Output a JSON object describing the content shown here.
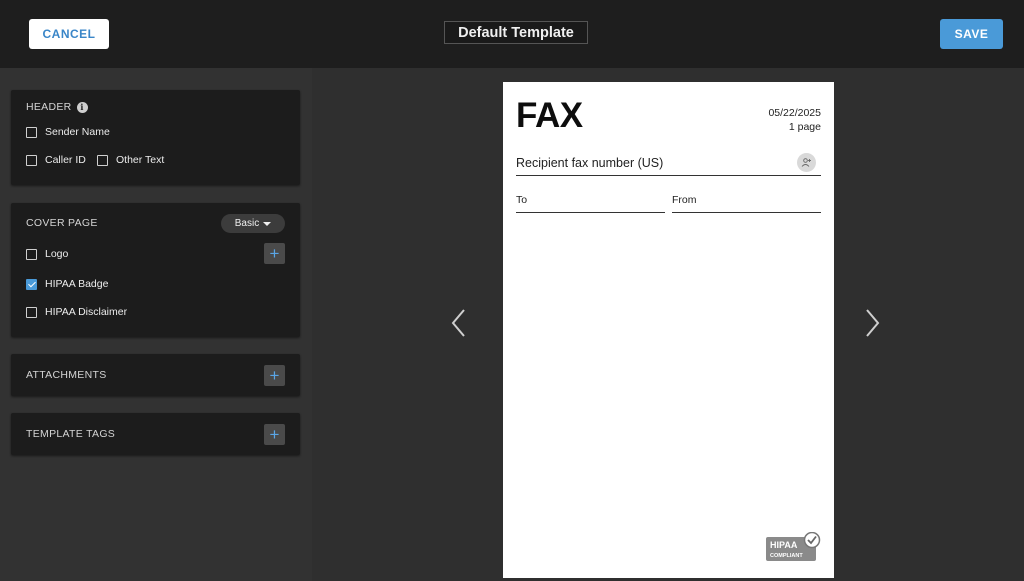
{
  "topbar": {
    "cancel_label": "CANCEL",
    "title": "Default Template",
    "save_label": "SAVE"
  },
  "left_panel": {
    "header": {
      "title": "HEADER",
      "options": [
        {
          "label": "Sender Name",
          "checked": false
        },
        {
          "label": "Caller ID",
          "checked": false
        },
        {
          "label": "Other Text",
          "checked": false
        }
      ]
    },
    "cover_page": {
      "title": "COVER PAGE",
      "style_selected": "Basic",
      "options": [
        {
          "label": "Logo",
          "checked": false
        },
        {
          "label": "HIPAA Badge",
          "checked": true
        },
        {
          "label": "HIPAA Disclaimer",
          "checked": false
        }
      ]
    },
    "attachments": {
      "title": "ATTACHMENTS"
    },
    "template_tags": {
      "title": "TEMPLATE TAGS"
    }
  },
  "preview": {
    "fax_title": "FAX",
    "date": "05/22/2025",
    "pages": "1 page",
    "recipient_placeholder": "Recipient fax number (US)",
    "to_label": "To",
    "from_label": "From",
    "badge_line1": "HIPAA",
    "badge_line2": "COMPLIANT"
  },
  "colors": {
    "accent": "#4a9ad8",
    "topbar_bg": "#1e1e1e",
    "panel_bg": "#323232",
    "section_bg": "#1c1c1c"
  },
  "icons": [
    "info-icon",
    "plus-icon",
    "chevron-left-icon",
    "chevron-right-icon",
    "contact-add-icon",
    "check-icon",
    "caret-down-icon"
  ]
}
